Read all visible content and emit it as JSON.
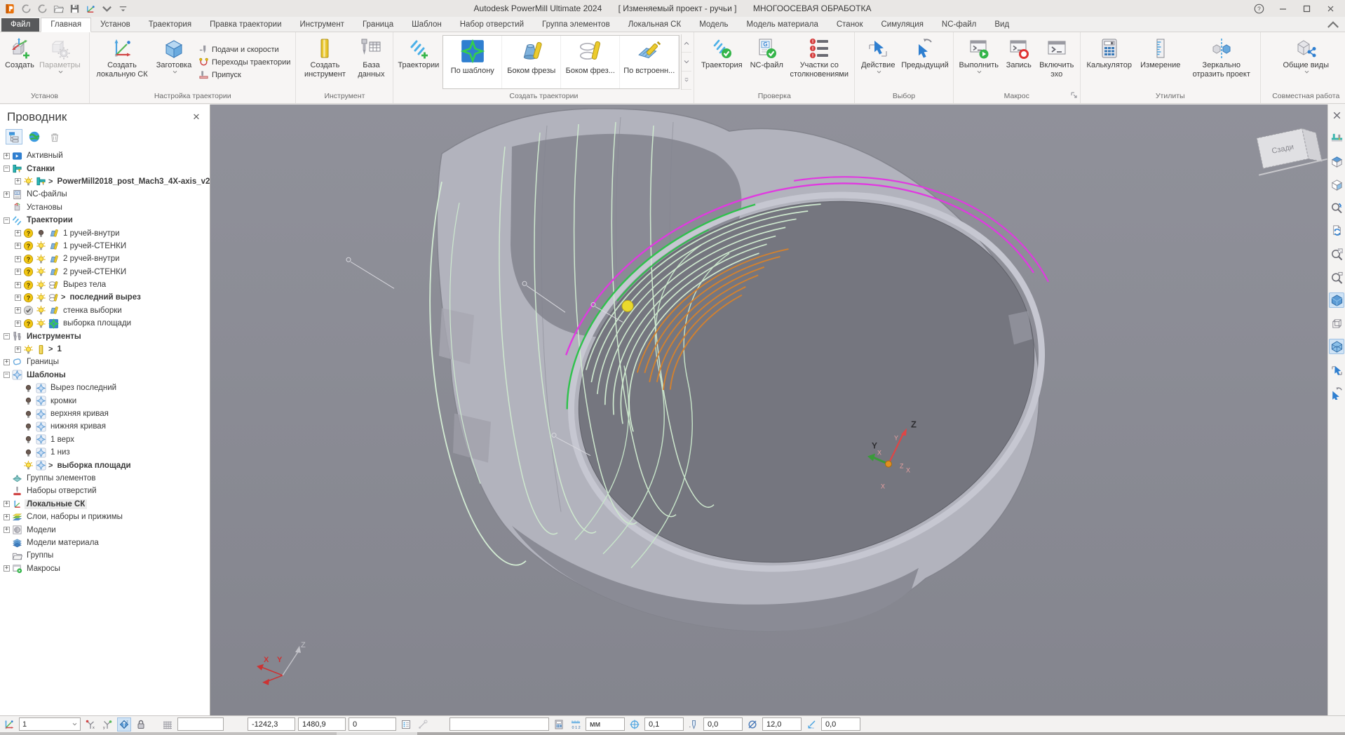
{
  "titlebar": {
    "app": "Autodesk PowerMill Ultimate 2024",
    "project": "[ Изменяемый проект - ручьи ]",
    "mode": "МНОГООСЕВАЯ ОБРАБОТКА"
  },
  "tabs": [
    {
      "label": "Файл",
      "type": "file"
    },
    {
      "label": "Главная",
      "type": "active"
    },
    {
      "label": "Установ"
    },
    {
      "label": "Траектория"
    },
    {
      "label": "Правка траектории"
    },
    {
      "label": "Инструмент"
    },
    {
      "label": "Граница"
    },
    {
      "label": "Шаблон"
    },
    {
      "label": "Набор отверстий"
    },
    {
      "label": "Группа элементов"
    },
    {
      "label": "Локальная СК"
    },
    {
      "label": "Модель"
    },
    {
      "label": "Модель материала"
    },
    {
      "label": "Станок"
    },
    {
      "label": "Симуляция"
    },
    {
      "label": "NC-файл"
    },
    {
      "label": "Вид"
    }
  ],
  "ribbon": {
    "setup": {
      "label": "Установ",
      "create": "Создать",
      "params": "Параметры"
    },
    "tp_setup": {
      "label": "Настройка траектории",
      "create_cs": "Создать локальную СК",
      "stock": "Заготовка",
      "feeds": "Подачи и скорости",
      "links": "Переходы траектории",
      "thickness": "Припуск"
    },
    "tool": {
      "label": "Инструмент",
      "create_tool": "Создать инструмент",
      "database": "База данных"
    },
    "create_tp": {
      "label": "Создать траектории",
      "toolpaths": "Траектории",
      "gallery": [
        {
          "label": "По шаблону",
          "icon": "galPattern"
        },
        {
          "label": "Боком фрезы",
          "icon": "galCone"
        },
        {
          "label": "Боком фрез...",
          "icon": "galLoop"
        },
        {
          "label": "По встроенн...",
          "icon": "galEmbed"
        }
      ]
    },
    "verify": {
      "label": "Проверка",
      "toolpath": "Траектория",
      "nc": "NC-файл",
      "collisions": "Участки со столкновениями"
    },
    "select": {
      "label": "Выбор",
      "action": "Действие",
      "previous": "Предыдущий"
    },
    "macro": {
      "label": "Макрос",
      "run": "Выполнить",
      "record": "Запись",
      "echo": "Включить эхо"
    },
    "utils": {
      "label": "Утилиты",
      "calc": "Калькулятор",
      "measure": "Измерение",
      "mirror": "Зеркально отразить проект"
    },
    "collab": {
      "label": "Совместная работа",
      "views": "Общие виды"
    }
  },
  "explorer": {
    "title": "Проводник",
    "tree": [
      {
        "exp": "p",
        "icons": [
          "active"
        ],
        "label": "Активный"
      },
      {
        "exp": "m",
        "icons": [
          "machine"
        ],
        "label": "Станки",
        "bold": true
      },
      {
        "exp": "p",
        "indent": 1,
        "icons": [
          "bulbOn",
          "machine"
        ],
        "label": "PowerMill2018_post_Mach3_4X-axis_v2",
        "bold": true,
        "arrow": true
      },
      {
        "exp": "p",
        "icons": [
          "ncdoc"
        ],
        "label": "NC-файлы"
      },
      {
        "exp": "n",
        "icons": [
          "setup"
        ],
        "label": "Установы"
      },
      {
        "exp": "m",
        "icons": [
          "tpaths"
        ],
        "label": "Траектории",
        "bold": true
      },
      {
        "exp": "p",
        "indent": 1,
        "icons": [
          "q",
          "bulbOff",
          "coneTool"
        ],
        "label": "1 ручей-внутри"
      },
      {
        "exp": "p",
        "indent": 1,
        "icons": [
          "q",
          "bulbOn",
          "coneTool"
        ],
        "label": "1 ручей-СТЕНКИ"
      },
      {
        "exp": "p",
        "indent": 1,
        "icons": [
          "q",
          "bulbOn",
          "coneTool"
        ],
        "label": "2 ручей-внутри"
      },
      {
        "exp": "p",
        "indent": 1,
        "icons": [
          "q",
          "bulbOn",
          "coneTool"
        ],
        "label": "2 ручей-СТЕНКИ"
      },
      {
        "exp": "p",
        "indent": 1,
        "icons": [
          "q",
          "bulbOn",
          "barrelTool"
        ],
        "label": "Вырез тела"
      },
      {
        "exp": "p",
        "indent": 1,
        "icons": [
          "q",
          "bulbOn",
          "barrelTool"
        ],
        "label": "последний вырез",
        "bold": true,
        "arrow": true
      },
      {
        "exp": "p",
        "indent": 1,
        "icons": [
          "chk",
          "bulbOn",
          "coneTool"
        ],
        "label": "стенка выборки"
      },
      {
        "exp": "p",
        "indent": 1,
        "icons": [
          "q",
          "bulbOn",
          "xpatG"
        ],
        "label": "выборка площади"
      },
      {
        "exp": "m",
        "icons": [
          "toolsGrp"
        ],
        "label": "Инструменты",
        "bold": true
      },
      {
        "exp": "p",
        "indent": 1,
        "icons": [
          "bulbOn",
          "toolMill"
        ],
        "label": "1",
        "bold": true,
        "arrow": true
      },
      {
        "exp": "p",
        "icons": [
          "boundary"
        ],
        "label": "Границы"
      },
      {
        "exp": "m",
        "icons": [
          "xpat"
        ],
        "label": "Шаблоны",
        "bold": true
      },
      {
        "exp": "n",
        "indent": 1,
        "icons": [
          "bulbOff",
          "xpat"
        ],
        "label": "Вырез последний"
      },
      {
        "exp": "n",
        "indent": 1,
        "icons": [
          "bulbOff",
          "xpat"
        ],
        "label": "кромки"
      },
      {
        "exp": "n",
        "indent": 1,
        "icons": [
          "bulbOff",
          "xpat"
        ],
        "label": "верхняя кривая"
      },
      {
        "exp": "n",
        "indent": 1,
        "icons": [
          "bulbOff",
          "xpat"
        ],
        "label": "нижняя кривая"
      },
      {
        "exp": "n",
        "indent": 1,
        "icons": [
          "bulbOff",
          "xpat"
        ],
        "label": "1 верх"
      },
      {
        "exp": "n",
        "indent": 1,
        "icons": [
          "bulbOff",
          "xpat"
        ],
        "label": "1 низ"
      },
      {
        "exp": "n",
        "indent": 1,
        "icons": [
          "bulbOn",
          "xpat"
        ],
        "label": "выборка площади",
        "bold": true,
        "arrow": true
      },
      {
        "exp": "n",
        "icons": [
          "featGrp"
        ],
        "label": "Группы элементов"
      },
      {
        "exp": "n",
        "icons": [
          "holes"
        ],
        "label": "Наборы отверстий"
      },
      {
        "exp": "p",
        "icons": [
          "wplane"
        ],
        "label": "Локальные СК",
        "bold": true,
        "highlight": true
      },
      {
        "exp": "p",
        "icons": [
          "layers"
        ],
        "label": "Слои, наборы и прижимы"
      },
      {
        "exp": "p",
        "icons": [
          "models"
        ],
        "label": "Модели"
      },
      {
        "exp": "n",
        "icons": [
          "stockM"
        ],
        "label": "Модели материала"
      },
      {
        "exp": "n",
        "icons": [
          "folder"
        ],
        "label": "Группы"
      },
      {
        "exp": "p",
        "icons": [
          "macros"
        ],
        "label": "Макросы"
      }
    ]
  },
  "viewport": {
    "cube": "Сзади",
    "ax_z": "Z",
    "ax_y": "Y",
    "ax_x": "X"
  },
  "right_toolbar": [
    {
      "name": "close-panel",
      "icon": "rtClose"
    },
    {
      "name": "machine-simulation",
      "icon": "rtMachine"
    },
    {
      "name": "iso-view",
      "icon": "rtIso"
    },
    {
      "name": "view-orientation",
      "icon": "rtCorner"
    },
    {
      "name": "reset-view",
      "icon": "rtZoomReset"
    },
    {
      "name": "refresh-view",
      "icon": "rtRefresh"
    },
    {
      "name": "zoom-to-fit",
      "icon": "rtZoomFit"
    },
    {
      "name": "zoom-window",
      "icon": "rtZoomWin"
    },
    {
      "name": "shaded-view",
      "icon": "rtShaded",
      "active": true
    },
    {
      "name": "wireframe-view",
      "icon": "rtWire"
    },
    {
      "name": "shaded-wireframe-view",
      "icon": "rtShadedWire",
      "active": true
    },
    {
      "name": "select-box",
      "icon": "rtSelBox"
    },
    {
      "name": "select-undo",
      "icon": "rtSelUndo"
    }
  ],
  "statusbar": {
    "workplane": "1",
    "x": "-1242,3",
    "y": "1480,9",
    "z": "0",
    "message": "",
    "units": "мм",
    "tolerance": "0,1",
    "thickness": "0,0",
    "diameter": "12,0",
    "azimuth": "0,0"
  }
}
